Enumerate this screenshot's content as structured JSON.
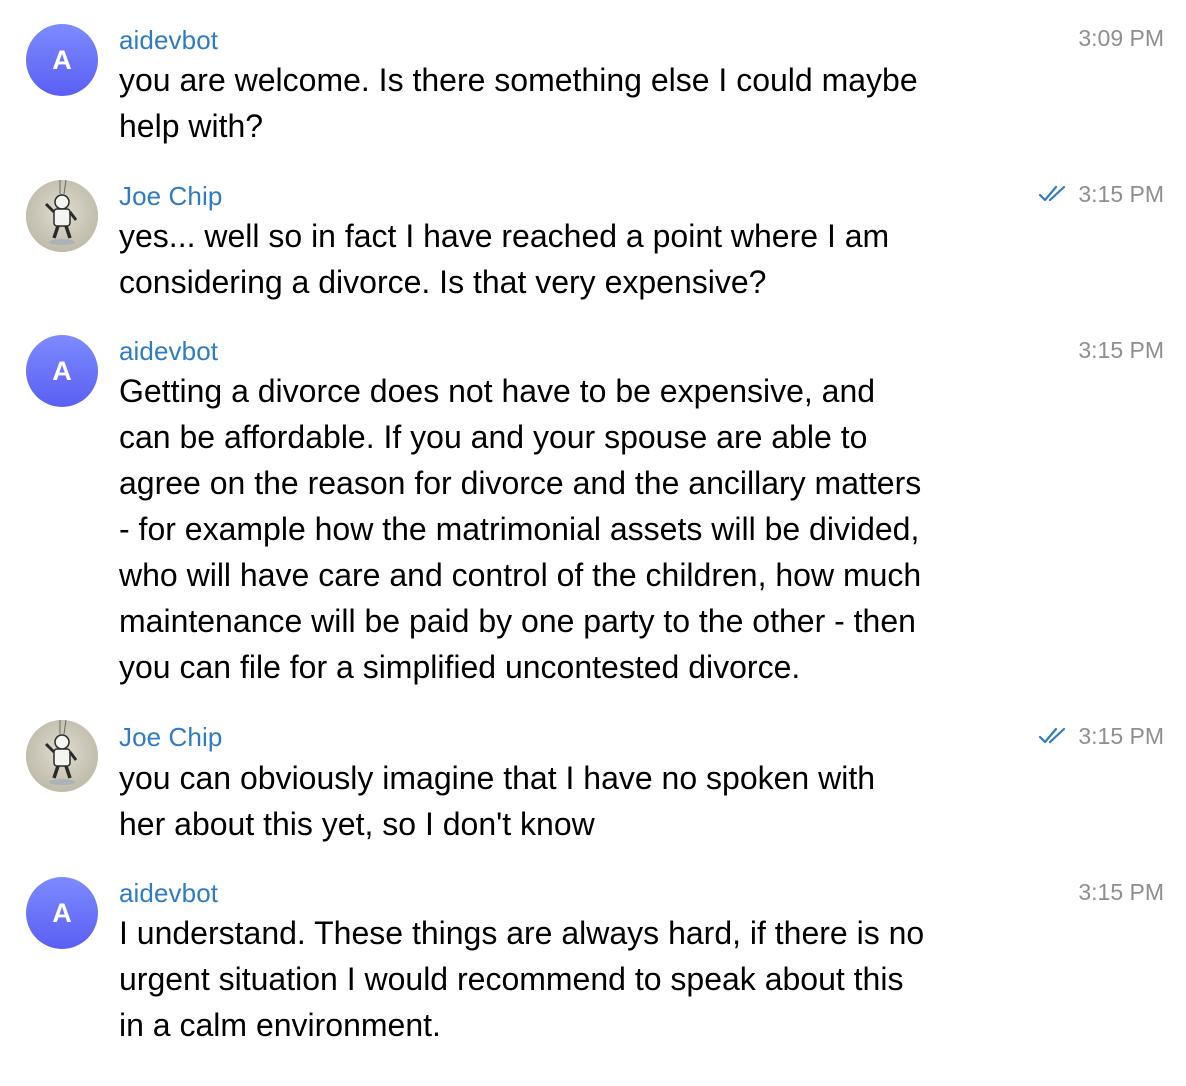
{
  "messages": [
    {
      "sender": "aidevbot",
      "avatar_letter": "A",
      "time": "3:09 PM",
      "text": "you are welcome. Is there something else I could maybe\nhelp with?"
    },
    {
      "sender": "Joe Chip",
      "avatar_icon": "astronaut-photo-avatar",
      "time": "3:15 PM",
      "read_status_icon": "double-check-icon",
      "text": "yes... well so in fact I have reached a point where I am\nconsidering a divorce. Is that very expensive?"
    },
    {
      "sender": "aidevbot",
      "avatar_letter": "A",
      "time": "3:15 PM",
      "text": "Getting a divorce does not have to be expensive, and\ncan be affordable. If you and your spouse are able to\nagree on the reason for divorce and the ancillary matters\n- for example how the matrimonial assets will be divided,\nwho will have care and control of the children, how much\nmaintenance will be paid by one party to the other - then\nyou can file for a simplified uncontested divorce."
    },
    {
      "sender": "Joe Chip",
      "avatar_icon": "astronaut-photo-avatar",
      "time": "3:15 PM",
      "read_status_icon": "double-check-icon",
      "text": "you can obviously imagine that I have no spoken with\nher about this yet, so I don't know"
    },
    {
      "sender": "aidevbot",
      "avatar_letter": "A",
      "time": "3:15 PM",
      "text": "I understand. These things are always hard, if there is no\nurgent situation I would recommend to speak about this\nin a calm environment."
    }
  ],
  "colors": {
    "sender_name": "#2f7bc4",
    "timestamp": "#8e8e93",
    "read_check": "#2f7bc4",
    "bot_avatar_gradient": [
      "#7d8bff",
      "#5a5ff3"
    ]
  }
}
